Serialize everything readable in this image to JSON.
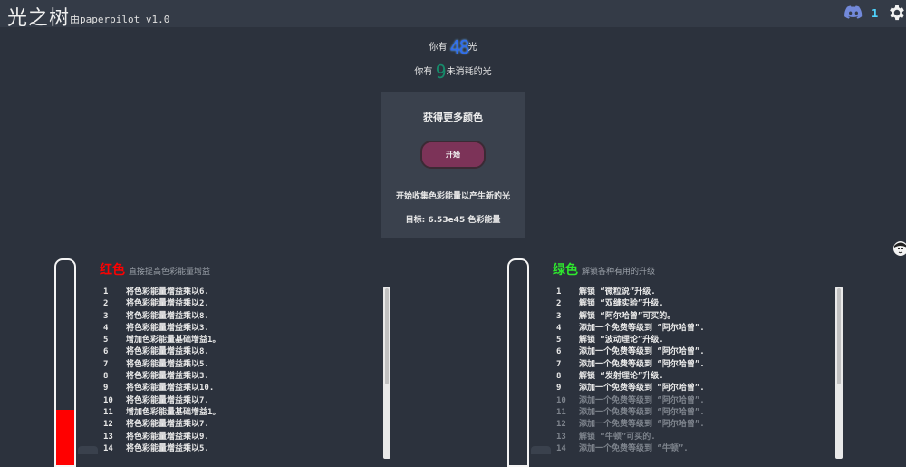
{
  "app": {
    "title": "光之树",
    "byline": "由paperpilot v1.0"
  },
  "topbar": {
    "discord_icon": "discord-icon",
    "count": "1",
    "settings_icon": "gear-icon"
  },
  "stats": {
    "light_prefix": "你有",
    "light_value": "48",
    "light_suffix": "光",
    "unspent_prefix": "你有",
    "unspent_value": "9",
    "unspent_suffix": "未消耗的光"
  },
  "challenge": {
    "title": "获得更多颜色",
    "button": "开始",
    "description": "开始收集色彩能量以产生新的光",
    "goal": "目标: 6.53e45 色彩能量"
  },
  "red": {
    "name": "红色",
    "color": "#ff0000",
    "subtitle": "直接提高色彩能量增益",
    "fill_fraction": 0.27,
    "items": [
      {
        "n": "1",
        "t": "将色彩能量增益乘以6."
      },
      {
        "n": "2",
        "t": "将色彩能量增益乘以2."
      },
      {
        "n": "3",
        "t": "将色彩能量增益乘以8."
      },
      {
        "n": "4",
        "t": "将色彩能量增益乘以3."
      },
      {
        "n": "5",
        "t": "增加色彩能量基础增益1。"
      },
      {
        "n": "6",
        "t": "将色彩能量增益乘以8."
      },
      {
        "n": "7",
        "t": "将色彩能量增益乘以5."
      },
      {
        "n": "8",
        "t": "将色彩能量增益乘以3."
      },
      {
        "n": "9",
        "t": "将色彩能量增益乘以10."
      },
      {
        "n": "10",
        "t": "将色彩能量增益乘以7."
      },
      {
        "n": "11",
        "t": "增加色彩能量基础增益1。"
      },
      {
        "n": "12",
        "t": "将色彩能量增益乘以7."
      },
      {
        "n": "13",
        "t": "将色彩能量增益乘以9."
      },
      {
        "n": "14",
        "t": "将色彩能量增益乘以5."
      }
    ]
  },
  "green": {
    "name": "绿色",
    "color": "#2ee82e",
    "subtitle": "解锁各种有用的升级",
    "fill_fraction": 0,
    "items": [
      {
        "n": "1",
        "t": "解锁 “微粒说”升级."
      },
      {
        "n": "2",
        "t": "解锁 “双缝实验”升级."
      },
      {
        "n": "3",
        "t": "解锁 “阿尔哈曾”可买的。"
      },
      {
        "n": "4",
        "t": "添加一个免费等级到 “阿尔哈曾”."
      },
      {
        "n": "5",
        "t": "解锁 “波动理论”升级."
      },
      {
        "n": "6",
        "t": "添加一个免费等级到 “阿尔哈曾”."
      },
      {
        "n": "7",
        "t": "添加一个免费等级到 “阿尔哈曾”."
      },
      {
        "n": "8",
        "t": "解锁 “发射理论”升级."
      },
      {
        "n": "9",
        "t": "添加一个免费等级到 “阿尔哈曾”."
      },
      {
        "n": "10",
        "t": "添加一个免费等级到 “阿尔哈曾”."
      },
      {
        "n": "11",
        "t": "添加一个免费等级到 “阿尔哈曾”."
      },
      {
        "n": "12",
        "t": "添加一个免费等级到 “阿尔哈曾”."
      },
      {
        "n": "13",
        "t": "解锁 “牛顿”可买的."
      },
      {
        "n": "14",
        "t": "添加一个免费等级到 “牛顿”."
      }
    ],
    "unlocked_count": 9
  }
}
